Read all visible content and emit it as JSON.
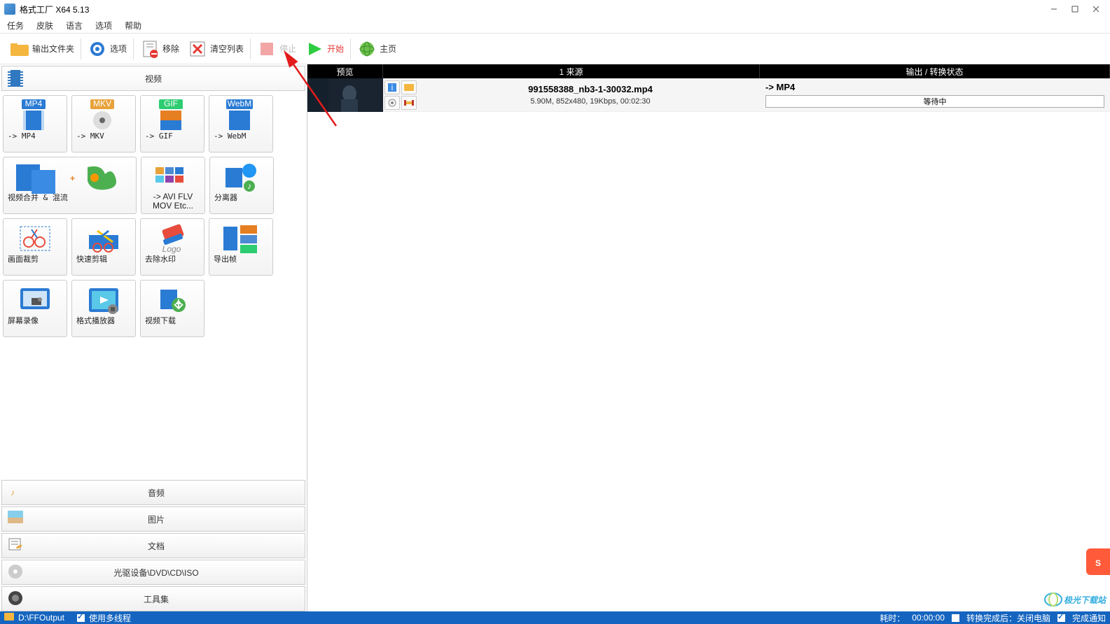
{
  "title": "格式工厂 X64 5.13",
  "menus": [
    "任务",
    "皮肤",
    "语言",
    "选项",
    "帮助"
  ],
  "toolbar": {
    "output_folder": "输出文件夹",
    "options": "选项",
    "remove": "移除",
    "clear_list": "清空列表",
    "stop": "停止",
    "start": "开始",
    "home": "主页"
  },
  "sidebar": {
    "video_header": "视频",
    "tiles": {
      "mp4": "-> MP4",
      "mkv": "-> MKV",
      "gif": "-> GIF",
      "webm": "-> WebM",
      "merge": "视频合并 & 混流",
      "avi_etc_l1": "-> AVI FLV",
      "avi_etc_l2": "MOV Etc...",
      "splitter": "分离器",
      "crop": "画面裁剪",
      "quickcut": "快速剪辑",
      "watermark": "去除水印",
      "export_frame": "导出帧",
      "screen_rec": "屏幕录像",
      "player": "格式播放器",
      "video_dl": "视频下载"
    },
    "tabs": {
      "audio": "音频",
      "image": "图片",
      "document": "文档",
      "optical": "光驱设备\\DVD\\CD\\ISO",
      "tools": "工具集"
    }
  },
  "task": {
    "headers": {
      "preview": "预览",
      "source": "1 来源",
      "output": "输出 / 转换状态"
    },
    "item": {
      "filename": "991558388_nb3-1-30032.mp4",
      "meta": "5.90M, 852x480, 19Kbps, 00:02:30",
      "format": "-> MP4",
      "status": "等待中"
    }
  },
  "statusbar": {
    "output_path": "D:\\FFOutput",
    "multithread": "使用多线程",
    "elapsed_label": "耗时：",
    "elapsed_time": "00:00:00",
    "after_done": "转换完成后：关闭电脑",
    "done_notify": "完成通知"
  },
  "watermark": "极光下载站"
}
